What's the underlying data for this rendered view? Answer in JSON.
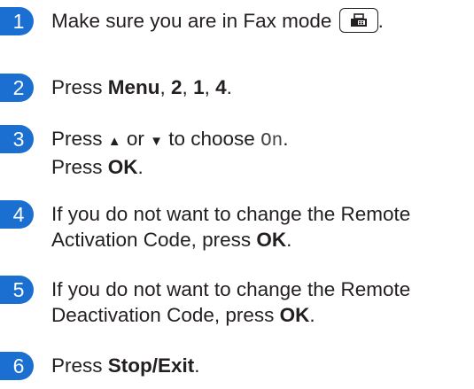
{
  "steps": [
    {
      "num": "1",
      "line1_pre": "Make sure you are in Fax mode",
      "fax_icon": "fax-mode-icon",
      "line1_post": "."
    },
    {
      "num": "2",
      "pre": "Press ",
      "menu": "Menu",
      "sep1": ", ",
      "k2": "2",
      "sep2": ", ",
      "k1": "1",
      "sep3": ", ",
      "k4": "4",
      "post": "."
    },
    {
      "num": "3",
      "pre": "Press ",
      "up": "▲",
      "mid": " or ",
      "down": "▼",
      "mid2": " to choose ",
      "value": "On",
      "post": ".",
      "line2_pre": "Press ",
      "ok": "OK",
      "line2_post": "."
    },
    {
      "num": "4",
      "line1": "If you do not want to change the Remote",
      "line2_pre": "Activation Code, press ",
      "ok": "OK",
      "line2_post": "."
    },
    {
      "num": "5",
      "line1": "If you do not want to change the Remote",
      "line2_pre": "Deactivation Code, press ",
      "ok": "OK",
      "line2_post": "."
    },
    {
      "num": "6",
      "pre": "Press ",
      "key": "Stop/Exit",
      "post": "."
    }
  ],
  "colors": {
    "badge": "#1a6fd0",
    "text": "#231f20"
  }
}
